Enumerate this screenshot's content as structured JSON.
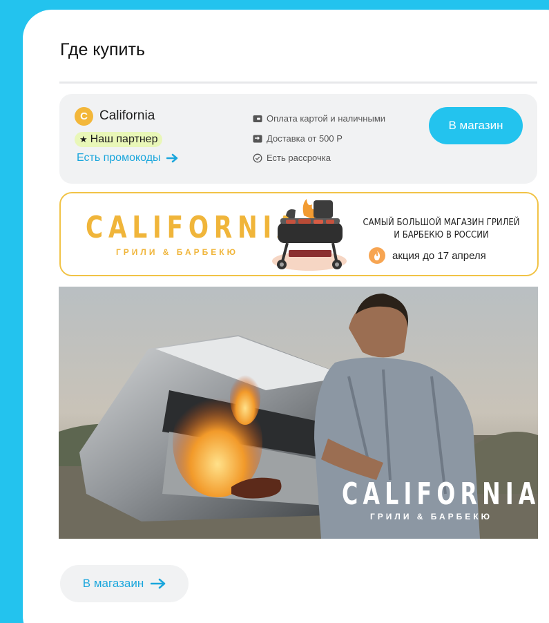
{
  "page": {
    "title": "Где купить"
  },
  "store": {
    "logo_letter": "C",
    "name": "California",
    "partner_badge": "Наш партнер",
    "promo_link": "Есть промокоды",
    "features": [
      {
        "icon": "card-icon",
        "text": "Оплата картой и наличными"
      },
      {
        "icon": "delivery-icon",
        "text": "Доставка от 500 Р"
      },
      {
        "icon": "check-circle-icon",
        "text": "Есть рассрочка"
      }
    ],
    "shop_button": "В магазин"
  },
  "banner": {
    "brand": "CALIFORNIA",
    "subtitle": "ГРИЛИ & БАРБЕКЮ",
    "slogan_line1": "САМЫЙ БОЛЬШОЙ МАГАЗИН ГРИЛЕЙ",
    "slogan_line2": "И БАРБЕКЮ В РОССИИ",
    "promo": "акция до 17 апреля"
  },
  "photo": {
    "brand": "CALIFORNIA",
    "subtitle": "ГРИЛИ & БАРБЕКЮ"
  },
  "bottom_button": "В магазаин",
  "colors": {
    "accent": "#23c3ee",
    "link": "#1aa6dc",
    "brand_gold": "#f0b53a",
    "badge_bg": "#e9f7b8"
  }
}
